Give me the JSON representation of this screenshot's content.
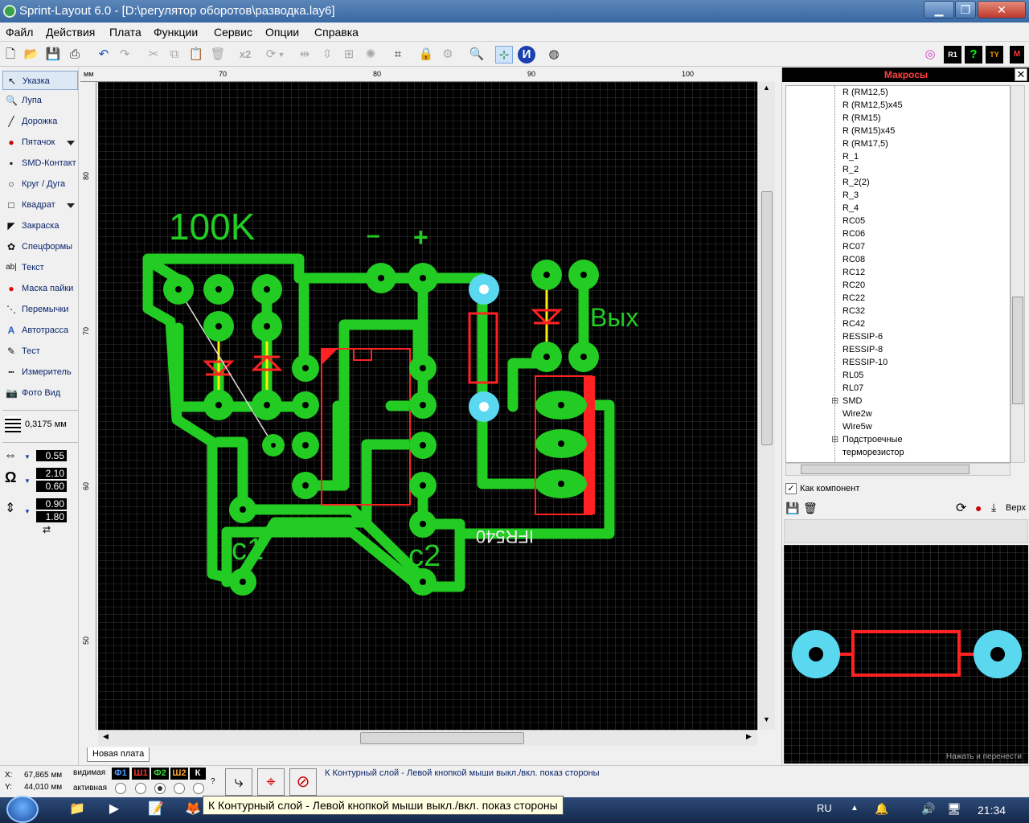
{
  "window": {
    "title": "Sprint-Layout 6.0 - [D:\\регулятор оборотов\\разводка.lay6]"
  },
  "menu": [
    "Файл",
    "Действия",
    "Плата",
    "Функции",
    "Сервис",
    "Опции",
    "Справка"
  ],
  "toolbar": {
    "zoom_label": "x2"
  },
  "tools": {
    "pointer": "Указка",
    "zoom": "Лупа",
    "track": "Дорожка",
    "pad": "Пятачок",
    "smd": "SMD-Контакт",
    "circle": "Круг / Дуга",
    "rect": "Квадрат",
    "fill": "Закраска",
    "special": "Спецформы",
    "text": "Текст",
    "mask": "Маска пайки",
    "jumpers": "Перемычки",
    "autoroute": "Автотрасса",
    "test": "Тест",
    "measure": "Измеритель",
    "photo": "Фото Вид"
  },
  "grid": {
    "label": "0,3175 мм"
  },
  "params": {
    "track_width": "0.55",
    "pad_outer": "2.10",
    "pad_inner": "0.60",
    "val_a": "0.90",
    "val_b": "1.80"
  },
  "ruler": {
    "unit": "мм",
    "top": [
      "70",
      "80",
      "90",
      "100"
    ],
    "left": [
      "80",
      "70",
      "60",
      "50"
    ]
  },
  "board": {
    "label_100k": "100K",
    "label_minus": "–",
    "label_plus": "+",
    "label_out": "Вых",
    "label_c1": "c1",
    "label_c2": "c2",
    "label_chip": "IFR540"
  },
  "tabs": {
    "board": "Новая плата"
  },
  "macros": {
    "title": "Макросы",
    "items": [
      "R (RM12,5)",
      "R (RM12,5)x45",
      "R (RM15)",
      "R (RM15)x45",
      "R (RM17,5)",
      "R_1",
      "R_2",
      "R_2(2)",
      "R_3",
      "R_4",
      "RC05",
      "RC06",
      "RC07",
      "RC08",
      "RC12",
      "RC20",
      "RC22",
      "RC32",
      "RC42",
      "RESSIP-6",
      "RESSIP-8",
      "RESSIP-10",
      "RL05",
      "RL07",
      "SMD",
      "Wire2w",
      "Wire5w",
      "Подстроечные",
      "терморезистор"
    ],
    "as_component": "Как компонент",
    "top_label": "Верх",
    "preview_hint": "Нажать и перенести"
  },
  "status": {
    "x_label": "X:",
    "x_value": "67,865 мм",
    "y_label": "Y:",
    "y_value": "44,010 мм",
    "visible": "видимая",
    "active": "активная",
    "layers": [
      "Ф1",
      "Ш1",
      "Ф2",
      "Ш2",
      "К"
    ],
    "help": "?",
    "message": "К Контурный слой - Левой кнопкой мыши выкл./вкл. показ стороны"
  },
  "taskbar": {
    "lang": "RU",
    "time": "21:34"
  },
  "tooltip": "К Контурный слой - Левой кнопкой мыши выкл./вкл. показ стороны",
  "colors": {
    "copper": "#22cc22",
    "silk_red": "#ff2222",
    "via_cyan": "#5ad8f0",
    "grid_bg": "#000000",
    "pin_yellow": "#ffee00"
  }
}
